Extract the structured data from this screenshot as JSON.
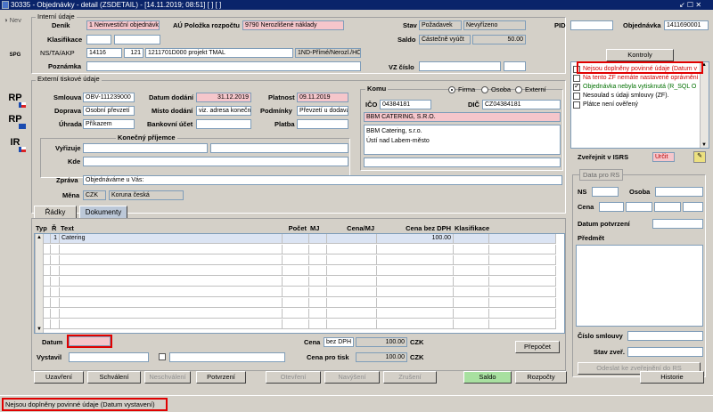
{
  "window": {
    "title": "30335 - Objednávky - detail (ZSDETAIL) - [14.11.2019; 08:51]  [ ]  [ ]",
    "controls": "↙ ☐ ✕"
  },
  "sidebar": {
    "nav_label": "Nev",
    "tools": [
      "SPG",
      "RP",
      "RP",
      "IR"
    ]
  },
  "interni": {
    "group_label": "Interní údaje",
    "denik_label": "Deník",
    "denik_value": "1 Neinvestiční objednávky",
    "au_label": "AÚ Položka rozpočtu",
    "au_value": "9790 Nerozlišené náklady",
    "klasifikace_label": "Klasifikace",
    "ns_label": "NS/TA/AKP",
    "ns_value": "14116",
    "ta_value": "121",
    "akp_value": "1211701D000 projekt TMAL",
    "ns_extra": "1ND-Přímé/Nerozl./HČ-D",
    "poznamka_label": "Poznámka",
    "stav_label": "Stav",
    "stav_value": "Požadavek",
    "stav_value2": "Nevyřízeno",
    "saldo_label": "Saldo",
    "saldo_text": "Částečně vyúčt",
    "saldo_value": "50.00",
    "pid_label": "PID",
    "objednavka_label": "Objednávka",
    "objednavka_value": "1411690001",
    "vz_label": "VZ číslo"
  },
  "externi": {
    "group_label": "Externí tiskové údaje",
    "smlouva_label": "Smlouva",
    "smlouva_value": "OBV-111239000",
    "doprava_label": "Doprava",
    "doprava_value": "Osobní převzetí",
    "uhrada_label": "Úhrada",
    "uhrada_value": "Příkazem",
    "datum_dodani_label": "Datum dodání",
    "datum_dodani_value": "31.12.2019",
    "misto_label": "Místo dodání",
    "misto_value": "viz. adresa konečné",
    "bankovni_label": "Bankovní účet",
    "platnost_label": "Platnost",
    "platnost_value": "09.11.2019",
    "podminky_label": "Podmínky",
    "podminky_value": "Převzetí u dodava",
    "platba_label": "Platba",
    "konecny_label": "Konečný příjemce",
    "vyrizuje_label": "Vyřizuje",
    "kde_label": "Kde",
    "zprava_label": "Zpráva",
    "zprava_value": "Objednáváme u Vás:",
    "mena_label": "Měna",
    "mena_code": "CZK",
    "mena_name": "Koruna česká"
  },
  "komu": {
    "group_label": "Komu",
    "radio_firma": "Firma",
    "radio_osoba": "Osoba",
    "radio_externi": "Externí",
    "ico_label": "IČO",
    "ico_value": "04384181",
    "dic_label": "DIČ",
    "dic_value": "CZ04384181",
    "firma_value": "BBM CATERING, S.R.O.",
    "address_line1": "BBM Catering, s.r.o.",
    "address_line2": "Ústí nad Labem-město"
  },
  "kontroly": {
    "button_label": "Kontroly",
    "items": [
      {
        "text": "Nejsou doplněny povinné údaje (Datum v",
        "color": "#d00000",
        "checked": false
      },
      {
        "text": "Na tento ZF nemáte nastavené oprávnění",
        "color": "#d00000",
        "checked": false
      },
      {
        "text": "Objednávka nebyla vytisknutá (R_SQL O",
        "color": "#007000",
        "checked": true
      },
      {
        "text": "Nesoulad s údaji smlouvy (ZF).",
        "color": "#000000",
        "checked": false
      },
      {
        "text": "Plátce není ověřený",
        "color": "#000000",
        "checked": false
      }
    ]
  },
  "isrs": {
    "label": "Zveřejnit v ISRS",
    "value": "Určit",
    "group_label": "Data pro RS",
    "ns_label": "NS",
    "osoba_label": "Osoba",
    "cena_label": "Cena",
    "datum_potvrzeni_label": "Datum potvrzení",
    "predmet_label": "Předmět",
    "cislo_smlouvy_label": "Číslo smlouvy",
    "stav_zver_label": "Stav zveř.",
    "odeslat_label": "Odeslat ke zveřejnění do RS"
  },
  "tabs": [
    {
      "label": "Řádky"
    },
    {
      "label": "Dokumenty"
    }
  ],
  "grid": {
    "headers": [
      "Typ",
      "Ř",
      "Text",
      "Počet",
      "MJ",
      "Cena/MJ",
      "Cena bez DPH",
      "Klasifikace"
    ],
    "rows": [
      {
        "r": "1",
        "text": "Catering",
        "cena_bez_dph": "100.00"
      }
    ]
  },
  "footer": {
    "datum_label": "Datum",
    "vystavil_label": "Vystavil",
    "cena_label": "Cena",
    "cena_type": "bez DPH",
    "cena_value": "100.00",
    "cena_cur": "CZK",
    "cena_tisk_label": "Cena pro tisk",
    "cena_tisk_value": "100.00",
    "cena_tisk_cur": "CZK",
    "prepocet_label": "Přepočet"
  },
  "buttons": {
    "uzavreni": "Uzavření",
    "schvaleni": "Schválení",
    "neschvaleni": "Neschválení",
    "potvrzeni": "Potvrzení",
    "otevreni": "Otevření",
    "navyseni": "Navýšení",
    "zruseni": "Zrušení",
    "saldo": "Saldo",
    "rozpocty": "Rozpočty",
    "historie": "Historie"
  },
  "status": {
    "message": "Nejsou doplněny povinné údaje (Datum vystavení)"
  }
}
